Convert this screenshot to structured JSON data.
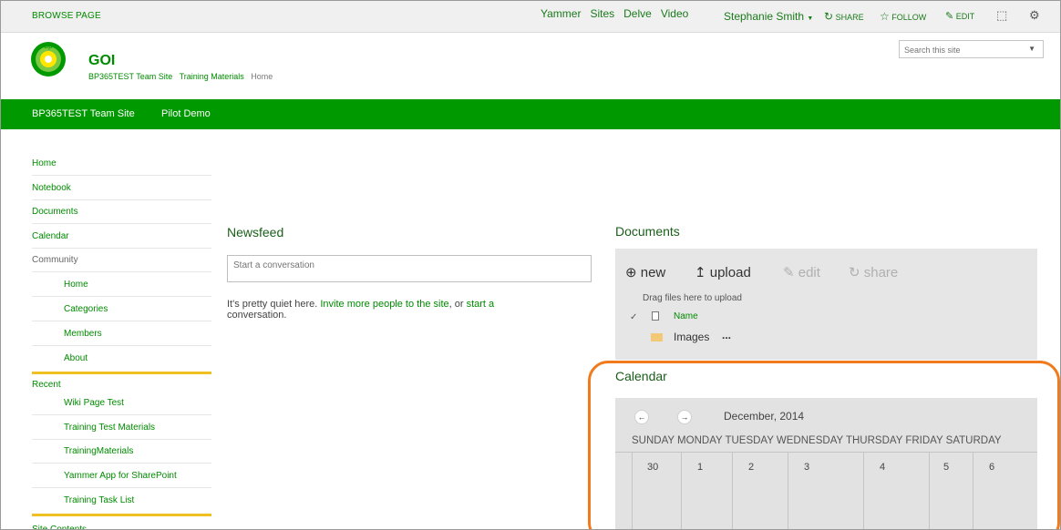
{
  "ribbon": {
    "tabs": [
      "BROWSE",
      "PAGE"
    ],
    "links": [
      "Yammer",
      "Sites",
      "Delve",
      "Video"
    ],
    "user": "Stephanie Smith",
    "share": "SHARE",
    "follow": "FOLLOW",
    "edit": "EDIT"
  },
  "header": {
    "logo_text": "bp",
    "site_title": "GOI",
    "breadcrumb": [
      "BP365TEST Team Site",
      "Training Materials",
      "Home"
    ],
    "search_placeholder": "Search this site"
  },
  "topnav": [
    "BP365TEST Team Site",
    "Pilot Demo"
  ],
  "leftnav": {
    "items": [
      "Home",
      "Notebook",
      "Documents",
      "Calendar",
      "Community"
    ],
    "community": [
      "Home",
      "Categories",
      "Members",
      "About"
    ],
    "recent_label": "Recent",
    "recent": [
      "Wiki Page Test",
      "Training Test Materials",
      "TrainingMaterials",
      "Yammer App for SharePoint",
      "Training Task List"
    ],
    "site_contents": "Site Contents"
  },
  "newsfeed": {
    "title": "Newsfeed",
    "placeholder": "Start a conversation",
    "quiet_1": "It's pretty quiet here. ",
    "invite_link": "Invite more people to the site",
    "quiet_2": ", or ",
    "start_link": "start a",
    "quiet_3": "conversation."
  },
  "documents": {
    "title": "Documents",
    "new": "new",
    "upload": "upload",
    "edit": "edit",
    "share": "share",
    "drag": "Drag files here to upload",
    "col_name": "Name",
    "folder": "Images",
    "more": "..."
  },
  "calendar": {
    "title": "Calendar",
    "month": "December, 2014",
    "days_of_week": "SUNDAY MONDAY TUESDAY WEDNESDAY THURSDAY FRIDAY SATURDAY",
    "dates": [
      "30",
      "1",
      "2",
      "3",
      "4",
      "5",
      "6"
    ]
  },
  "colors": {
    "brand_green": "#009900",
    "link_green": "#008a00",
    "highlight": "#f07a1c",
    "divider_yellow": "#f0c020"
  }
}
